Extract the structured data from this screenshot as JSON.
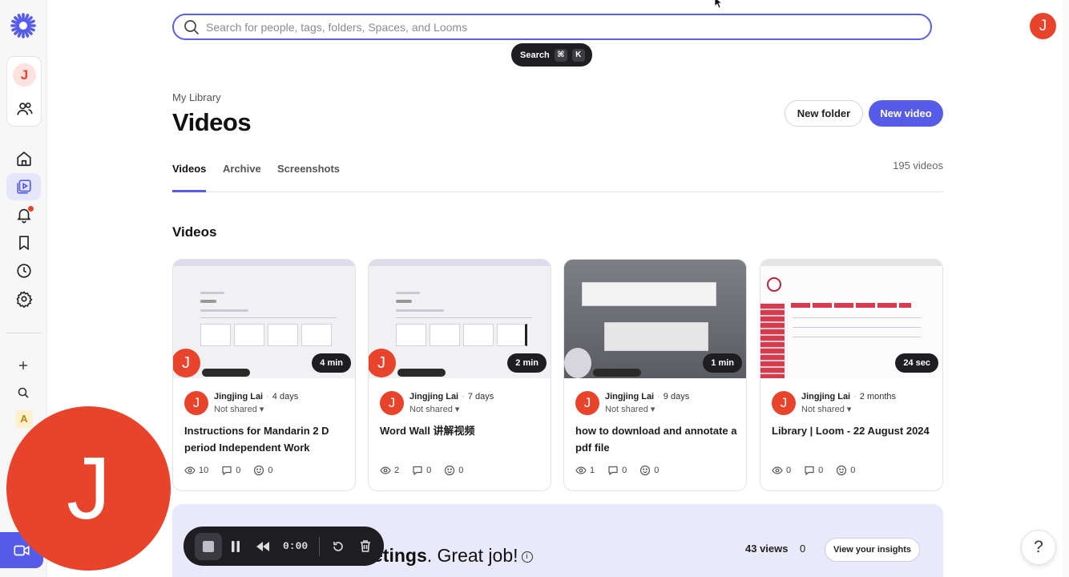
{
  "search": {
    "placeholder": "Search for people, tags, folders, Spaces, and Looms",
    "tooltip_label": "Search",
    "tooltip_key1": "⌘",
    "tooltip_key2": "K"
  },
  "user": {
    "initial": "J"
  },
  "rail": {
    "workspace_letter": "A"
  },
  "header": {
    "breadcrumb": "My Library",
    "title": "Videos",
    "new_folder_label": "New folder",
    "new_video_label": "New video"
  },
  "tabs": [
    {
      "label": "Videos",
      "active": true
    },
    {
      "label": "Archive",
      "active": false
    },
    {
      "label": "Screenshots",
      "active": false
    }
  ],
  "video_count": "195 videos",
  "section_title": "Videos",
  "videos": [
    {
      "duration": "4 min",
      "author": "Jingjing Lai",
      "age": "4 days",
      "share": "Not shared",
      "title": "Instructions for Mandarin 2 D period Independent Work",
      "views": "10",
      "comments": "0",
      "reactions": "0"
    },
    {
      "duration": "2 min",
      "author": "Jingjing Lai",
      "age": "7 days",
      "share": "Not shared",
      "title": "Word Wall 讲解视频",
      "views": "2",
      "comments": "0",
      "reactions": "0"
    },
    {
      "duration": "1 min",
      "author": "Jingjing Lai",
      "age": "9 days",
      "share": "Not shared",
      "title": "how to download and annotate a pdf file",
      "views": "1",
      "comments": "0",
      "reactions": "0"
    },
    {
      "duration": "24 sec",
      "author": "Jingjing Lai",
      "age": "2 months",
      "share": "Not shared",
      "title": "Library | Loom - 22 August 2024",
      "views": "0",
      "comments": "0",
      "reactions": "0"
    }
  ],
  "insights": {
    "text_bold": "etings",
    "text_rest": ". Great job!",
    "views": "43 views",
    "count": "0",
    "button_label": "View your insights"
  },
  "recorder": {
    "time": "0:00"
  },
  "help_label": "?",
  "colors": {
    "accent": "#565ce8",
    "avatar": "#e8432b"
  }
}
